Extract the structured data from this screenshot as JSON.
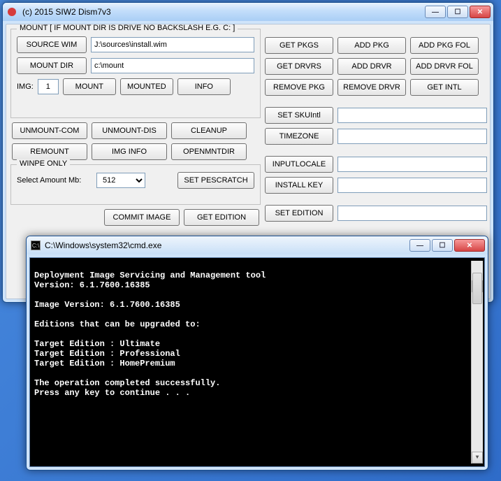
{
  "mainWindow": {
    "title": "(c) 2015 SIW2 Dism7v3",
    "mountLegend": "MOUNT    [ IF MOUNT DIR IS DRIVE NO BACKSLASH E.G. C: ]",
    "sourceWimBtn": "SOURCE WIM",
    "sourceWimVal": "J:\\sources\\install.wim",
    "mountDirBtn": "MOUNT DIR",
    "mountDirVal": "c:\\mount",
    "imgLbl": "IMG:",
    "imgVal": "1",
    "mountBtn": "MOUNT",
    "mountedBtn": "MOUNTED",
    "infoBtn": "INFO",
    "unmountCom": "UNMOUNT-COM",
    "unmountDis": "UNMOUNT-DIS",
    "cleanup": "CLEANUP",
    "remount": "REMOUNT",
    "imgInfo": "IMG INFO",
    "openMntDir": "OPENMNTDIR",
    "winpeLbl": "WINPE ONLY",
    "selectMbLbl": "Select Amount Mb:",
    "mbVal": "512",
    "setPescratch": "SET PESCRATCH",
    "commitImage": "COMMIT IMAGE",
    "getEdition": "GET EDITION",
    "getPkgs": "GET PKGS",
    "addPkg": "ADD PKG",
    "addPkgFol": "ADD PKG FOL",
    "getDrvrs": "GET DRVRS",
    "addDrvr": "ADD DRVR",
    "addDrvrFol": "ADD DRVR FOL",
    "removePkg": "REMOVE PKG",
    "removeDrvr": "REMOVE DRVR",
    "getIntl": "GET INTL",
    "setSkuIntl": "SET SKUIntl",
    "timezone": "TIMEZONE",
    "inputLocale": "INPUTLOCALE",
    "installKey": "INSTALL KEY",
    "setEdition": "SET EDITION",
    "skuVal": "",
    "tzVal": "",
    "localeVal": "",
    "keyVal": "",
    "editionVal": ""
  },
  "cmdWindow": {
    "title": "C:\\Windows\\system32\\cmd.exe",
    "output": "\nDeployment Image Servicing and Management tool\nVersion: 6.1.7600.16385\n\nImage Version: 6.1.7600.16385\n\nEditions that can be upgraded to:\n\nTarget Edition : Ultimate\nTarget Edition : Professional\nTarget Edition : HomePremium\n\nThe operation completed successfully.\nPress any key to continue . . ."
  }
}
